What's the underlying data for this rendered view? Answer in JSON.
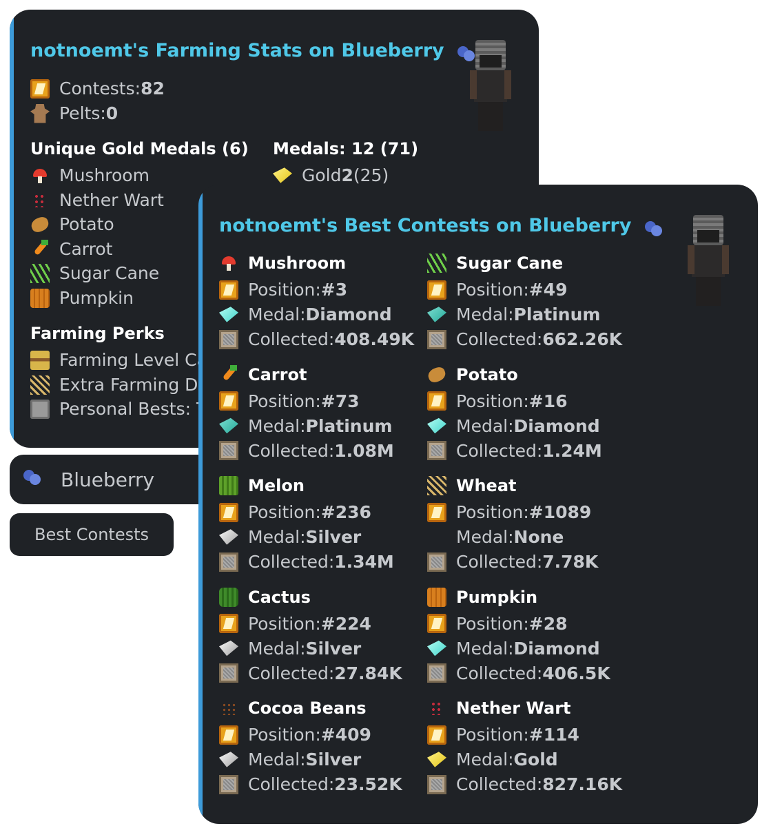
{
  "stats": {
    "title": "notnoemt's Farming Stats on Blueberry",
    "contests_label": "Contests: ",
    "contests_value": "82",
    "pelts_label": "Pelts: ",
    "pelts_value": "0",
    "unique_heading": "Unique Gold Medals (6)",
    "medals_heading": "Medals: 12 (71)",
    "gold_label": "Gold ",
    "gold_value": "2",
    "gold_extra": " (25)",
    "crops": [
      "Mushroom",
      "Nether Wart",
      "Potato",
      "Carrot",
      "Sugar Cane",
      "Pumpkin"
    ],
    "perks_heading": "Farming Perks",
    "perks": [
      "Farming Level Ca",
      "Extra Farming Dr",
      "Personal Bests: T"
    ]
  },
  "profile_button": {
    "label": "Blueberry",
    "icon": "blueberry-icon"
  },
  "best_button": {
    "label": "Best Contests"
  },
  "best": {
    "title": "notnoemt's Best Contests on Blueberry",
    "position_label": "Position: ",
    "medal_label": "Medal: ",
    "collected_label": "Collected: ",
    "entries": [
      {
        "crop": "Mushroom",
        "icon": "mushroom",
        "position": "#3",
        "medal": "Diamond",
        "medal_icon": "diamond",
        "collected": "408.49K"
      },
      {
        "crop": "Sugar Cane",
        "icon": "sugar-cane",
        "position": "#49",
        "medal": "Platinum",
        "medal_icon": "platinum",
        "collected": "662.26K"
      },
      {
        "crop": "Carrot",
        "icon": "carrot",
        "position": "#73",
        "medal": "Platinum",
        "medal_icon": "platinum",
        "collected": "1.08M"
      },
      {
        "crop": "Potato",
        "icon": "potato",
        "position": "#16",
        "medal": "Diamond",
        "medal_icon": "diamond",
        "collected": "1.24M"
      },
      {
        "crop": "Melon",
        "icon": "melon",
        "position": "#236",
        "medal": "Silver",
        "medal_icon": "silver",
        "collected": "1.34M"
      },
      {
        "crop": "Wheat",
        "icon": "wheat",
        "position": "#1089",
        "medal": "None",
        "medal_icon": "none",
        "collected": "7.78K"
      },
      {
        "crop": "Cactus",
        "icon": "cactus",
        "position": "#224",
        "medal": "Silver",
        "medal_icon": "silver",
        "collected": "27.84K"
      },
      {
        "crop": "Pumpkin",
        "icon": "pumpkin",
        "position": "#28",
        "medal": "Diamond",
        "medal_icon": "diamond",
        "collected": "406.5K"
      },
      {
        "crop": "Cocoa Beans",
        "icon": "cocoa",
        "position": "#409",
        "medal": "Silver",
        "medal_icon": "silver",
        "collected": "23.52K"
      },
      {
        "crop": "Nether Wart",
        "icon": "nether-wart",
        "position": "#114",
        "medal": "Gold",
        "medal_icon": "gold",
        "collected": "827.16K"
      }
    ]
  },
  "colors": {
    "card_bg": "#1f2226",
    "accent": "#3d9bd9",
    "title": "#4fc8e8"
  }
}
